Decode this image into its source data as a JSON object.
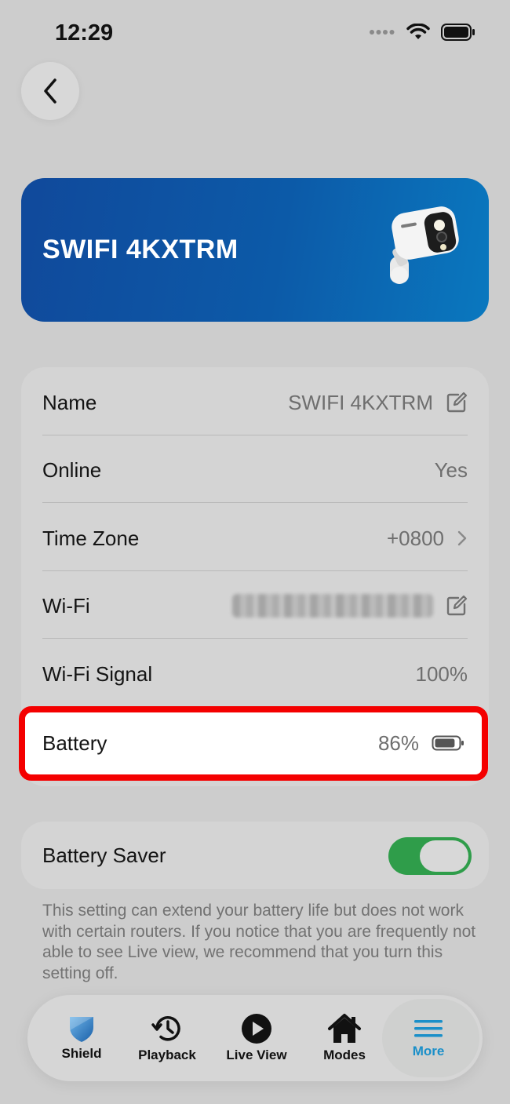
{
  "status_bar": {
    "time": "12:29"
  },
  "hero": {
    "title": "SWIFI 4KXTRM"
  },
  "details": {
    "rows": [
      {
        "label": "Name",
        "value": "SWIFI 4KXTRM"
      },
      {
        "label": "Online",
        "value": "Yes"
      },
      {
        "label": "Time Zone",
        "value": "+0800"
      },
      {
        "label": "Wi-Fi",
        "value": ""
      },
      {
        "label": "Wi-Fi Signal",
        "value": "100%"
      },
      {
        "label": "Battery",
        "value": "86%"
      }
    ]
  },
  "battery_level": 0.86,
  "battery_saver": {
    "label": "Battery Saver",
    "enabled": true,
    "description": "This setting can extend your battery life but does not work with certain routers. If you notice that you are frequently not able to see Live view, we recommend that you turn this setting off."
  },
  "tabs": [
    {
      "label": "Shield",
      "icon": "shield-icon"
    },
    {
      "label": "Playback",
      "icon": "history-icon"
    },
    {
      "label": "Live View",
      "icon": "play-icon"
    },
    {
      "label": "Modes",
      "icon": "home-icon"
    },
    {
      "label": "More",
      "icon": "menu-icon",
      "active": true
    }
  ],
  "colors": {
    "accent": "#1a8fc9",
    "toggle_on": "#2f9d4a",
    "highlight": "#f40000"
  }
}
